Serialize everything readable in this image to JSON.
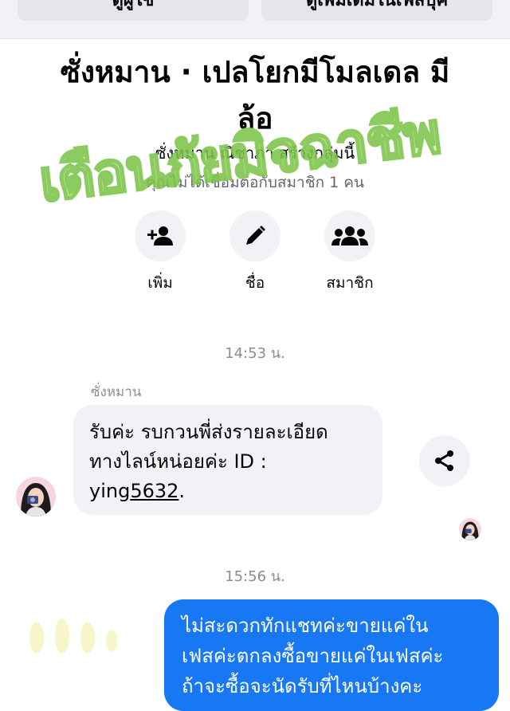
{
  "top_buttons": {
    "left_label": "ดูผู้ใช้",
    "right_label": "ดูเพิ่มเติมในเฟสบุ๊ค"
  },
  "group": {
    "title_line1": "ซั่งหมาน · เปลโยกมีโมลเดล มี",
    "title_line2": "ล้อ",
    "creator": "ซั่งหมาน ณิชาภา สร้างกลุ่มนี้",
    "connect_info": "คุณไม่ได้เชื่อมต่อกับสมาชิก 1 คน",
    "watermark": "เตือนภัยมิจฉาชีพ"
  },
  "actions": {
    "add_label": "เพิ่ม",
    "name_label": "ชื่อ",
    "members_label": "สมาชิก"
  },
  "messages": {
    "timestamp_1": "14:53 น.",
    "sender_name": "ซั่งหมาน",
    "incoming_line1": "รับค่ะ รบกวนพี่ส่งรายละเอียด",
    "incoming_line2": "ทางไลน์หน่อยค่ะ ID :",
    "incoming_id_prefix": "ying",
    "incoming_id_number": "5632",
    "incoming_id_suffix": ".",
    "timestamp_2": "15:56 น.",
    "outgoing_line1": "ไม่สะดวกทักแชทค่ะขายแค่ใน",
    "outgoing_line2": "เฟสค่ะตกลงซื้อขายแค่ในเฟสค่ะ",
    "outgoing_line3": "ถ้าจะซื้อจะนัดรับที่ไหนบ้างคะ"
  },
  "colors": {
    "accent": "#1877f2",
    "bubble_gray": "#f0f2f5",
    "watermark_fill": "#d9f7a0",
    "watermark_stroke": "#7cc44a"
  },
  "icons": {
    "add": "person-add-icon",
    "name": "pencil-icon",
    "members": "group-icon",
    "share": "share-icon"
  }
}
